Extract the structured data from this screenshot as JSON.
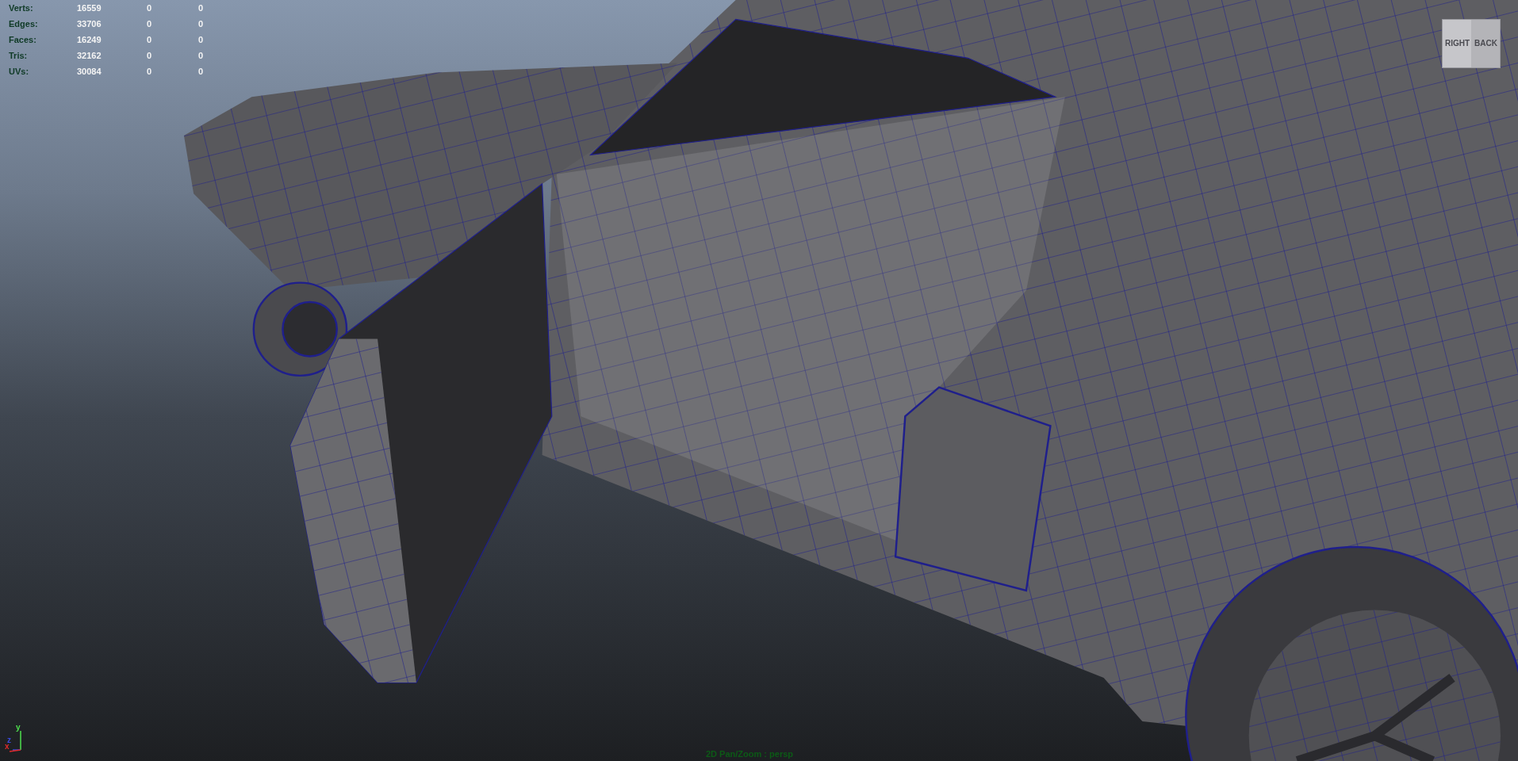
{
  "hud": {
    "rows": [
      {
        "label": "Verts:",
        "values": [
          "16559",
          "0",
          "0"
        ]
      },
      {
        "label": "Edges:",
        "values": [
          "33706",
          "0",
          "0"
        ]
      },
      {
        "label": "Faces:",
        "values": [
          "16249",
          "0",
          "0"
        ]
      },
      {
        "label": "Tris:",
        "values": [
          "32162",
          "0",
          "0"
        ]
      },
      {
        "label": "UVs:",
        "values": [
          "30084",
          "0",
          "0"
        ]
      }
    ]
  },
  "view_cube": {
    "faces": [
      "RIGHT",
      "BACK"
    ]
  },
  "axis_indicator": {
    "labels": [
      "y",
      "z",
      "x"
    ]
  },
  "camera_label": "2D Pan/Zoom : persp"
}
